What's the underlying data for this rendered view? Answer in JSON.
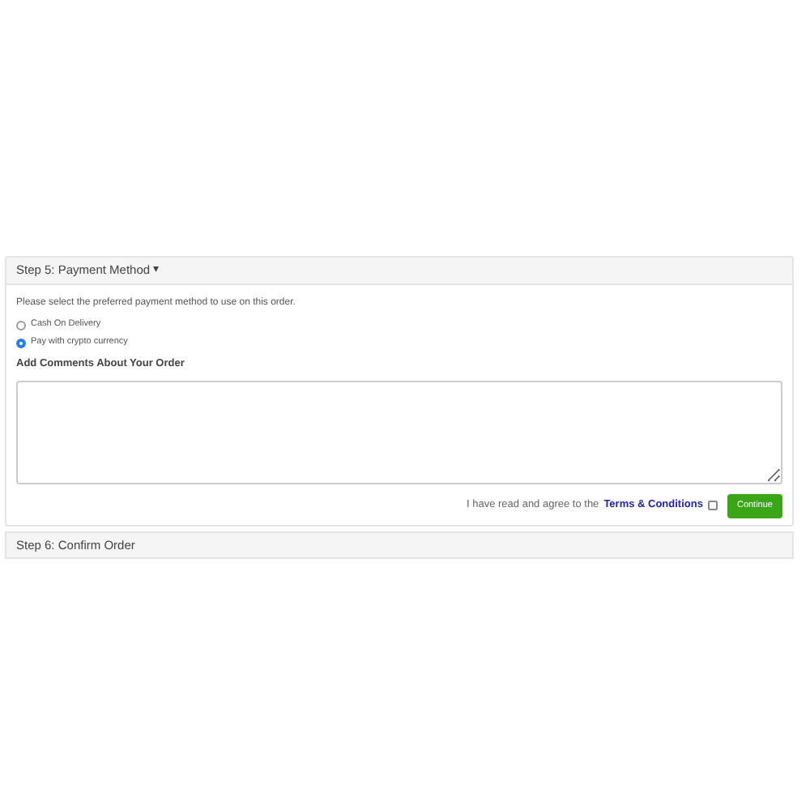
{
  "payment_panel": {
    "title": "Step 5: Payment Method",
    "caret": "▾",
    "instruction": "Please select the preferred payment method to use on this order.",
    "options": [
      {
        "label": "Cash On Delivery",
        "selected": false
      },
      {
        "label": "Pay with crypto currency",
        "selected": true
      }
    ],
    "comments_label": "Add Comments About Your Order",
    "agree_text": "I have read and agree to the",
    "terms_link": "Terms & Conditions",
    "agree_checked": false,
    "continue_button": "Continue"
  },
  "confirm_panel": {
    "title": "Step 6: Confirm Order"
  }
}
